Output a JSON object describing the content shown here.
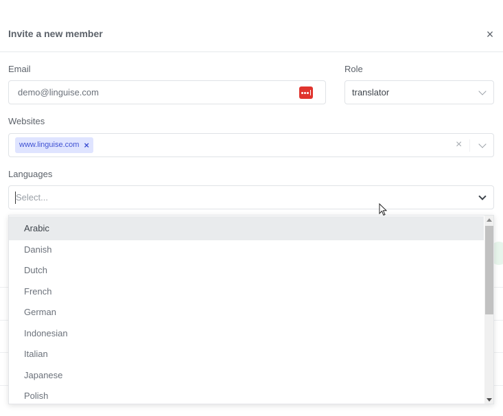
{
  "modal": {
    "title": "Invite a new member",
    "close_icon": "close-icon"
  },
  "form": {
    "email": {
      "label": "Email",
      "value": "demo@linguise.com",
      "icon": "password-manager-icon"
    },
    "role": {
      "label": "Role",
      "value": "translator"
    },
    "websites": {
      "label": "Websites",
      "tags": [
        {
          "label": "www.linguise.com"
        }
      ]
    },
    "languages": {
      "label": "Languages",
      "placeholder": "Select...",
      "options": [
        {
          "label": "Arabic",
          "highlighted": true
        },
        {
          "label": "Danish"
        },
        {
          "label": "Dutch"
        },
        {
          "label": "French"
        },
        {
          "label": "German"
        },
        {
          "label": "Indonesian"
        },
        {
          "label": "Italian"
        },
        {
          "label": "Japanese"
        },
        {
          "label": "Polish"
        }
      ]
    }
  },
  "colors": {
    "danger": "#e0342e",
    "tag_bg": "#dfe4ff",
    "tag_text": "#3f51d3",
    "highlight_bg": "#e9ebed"
  }
}
